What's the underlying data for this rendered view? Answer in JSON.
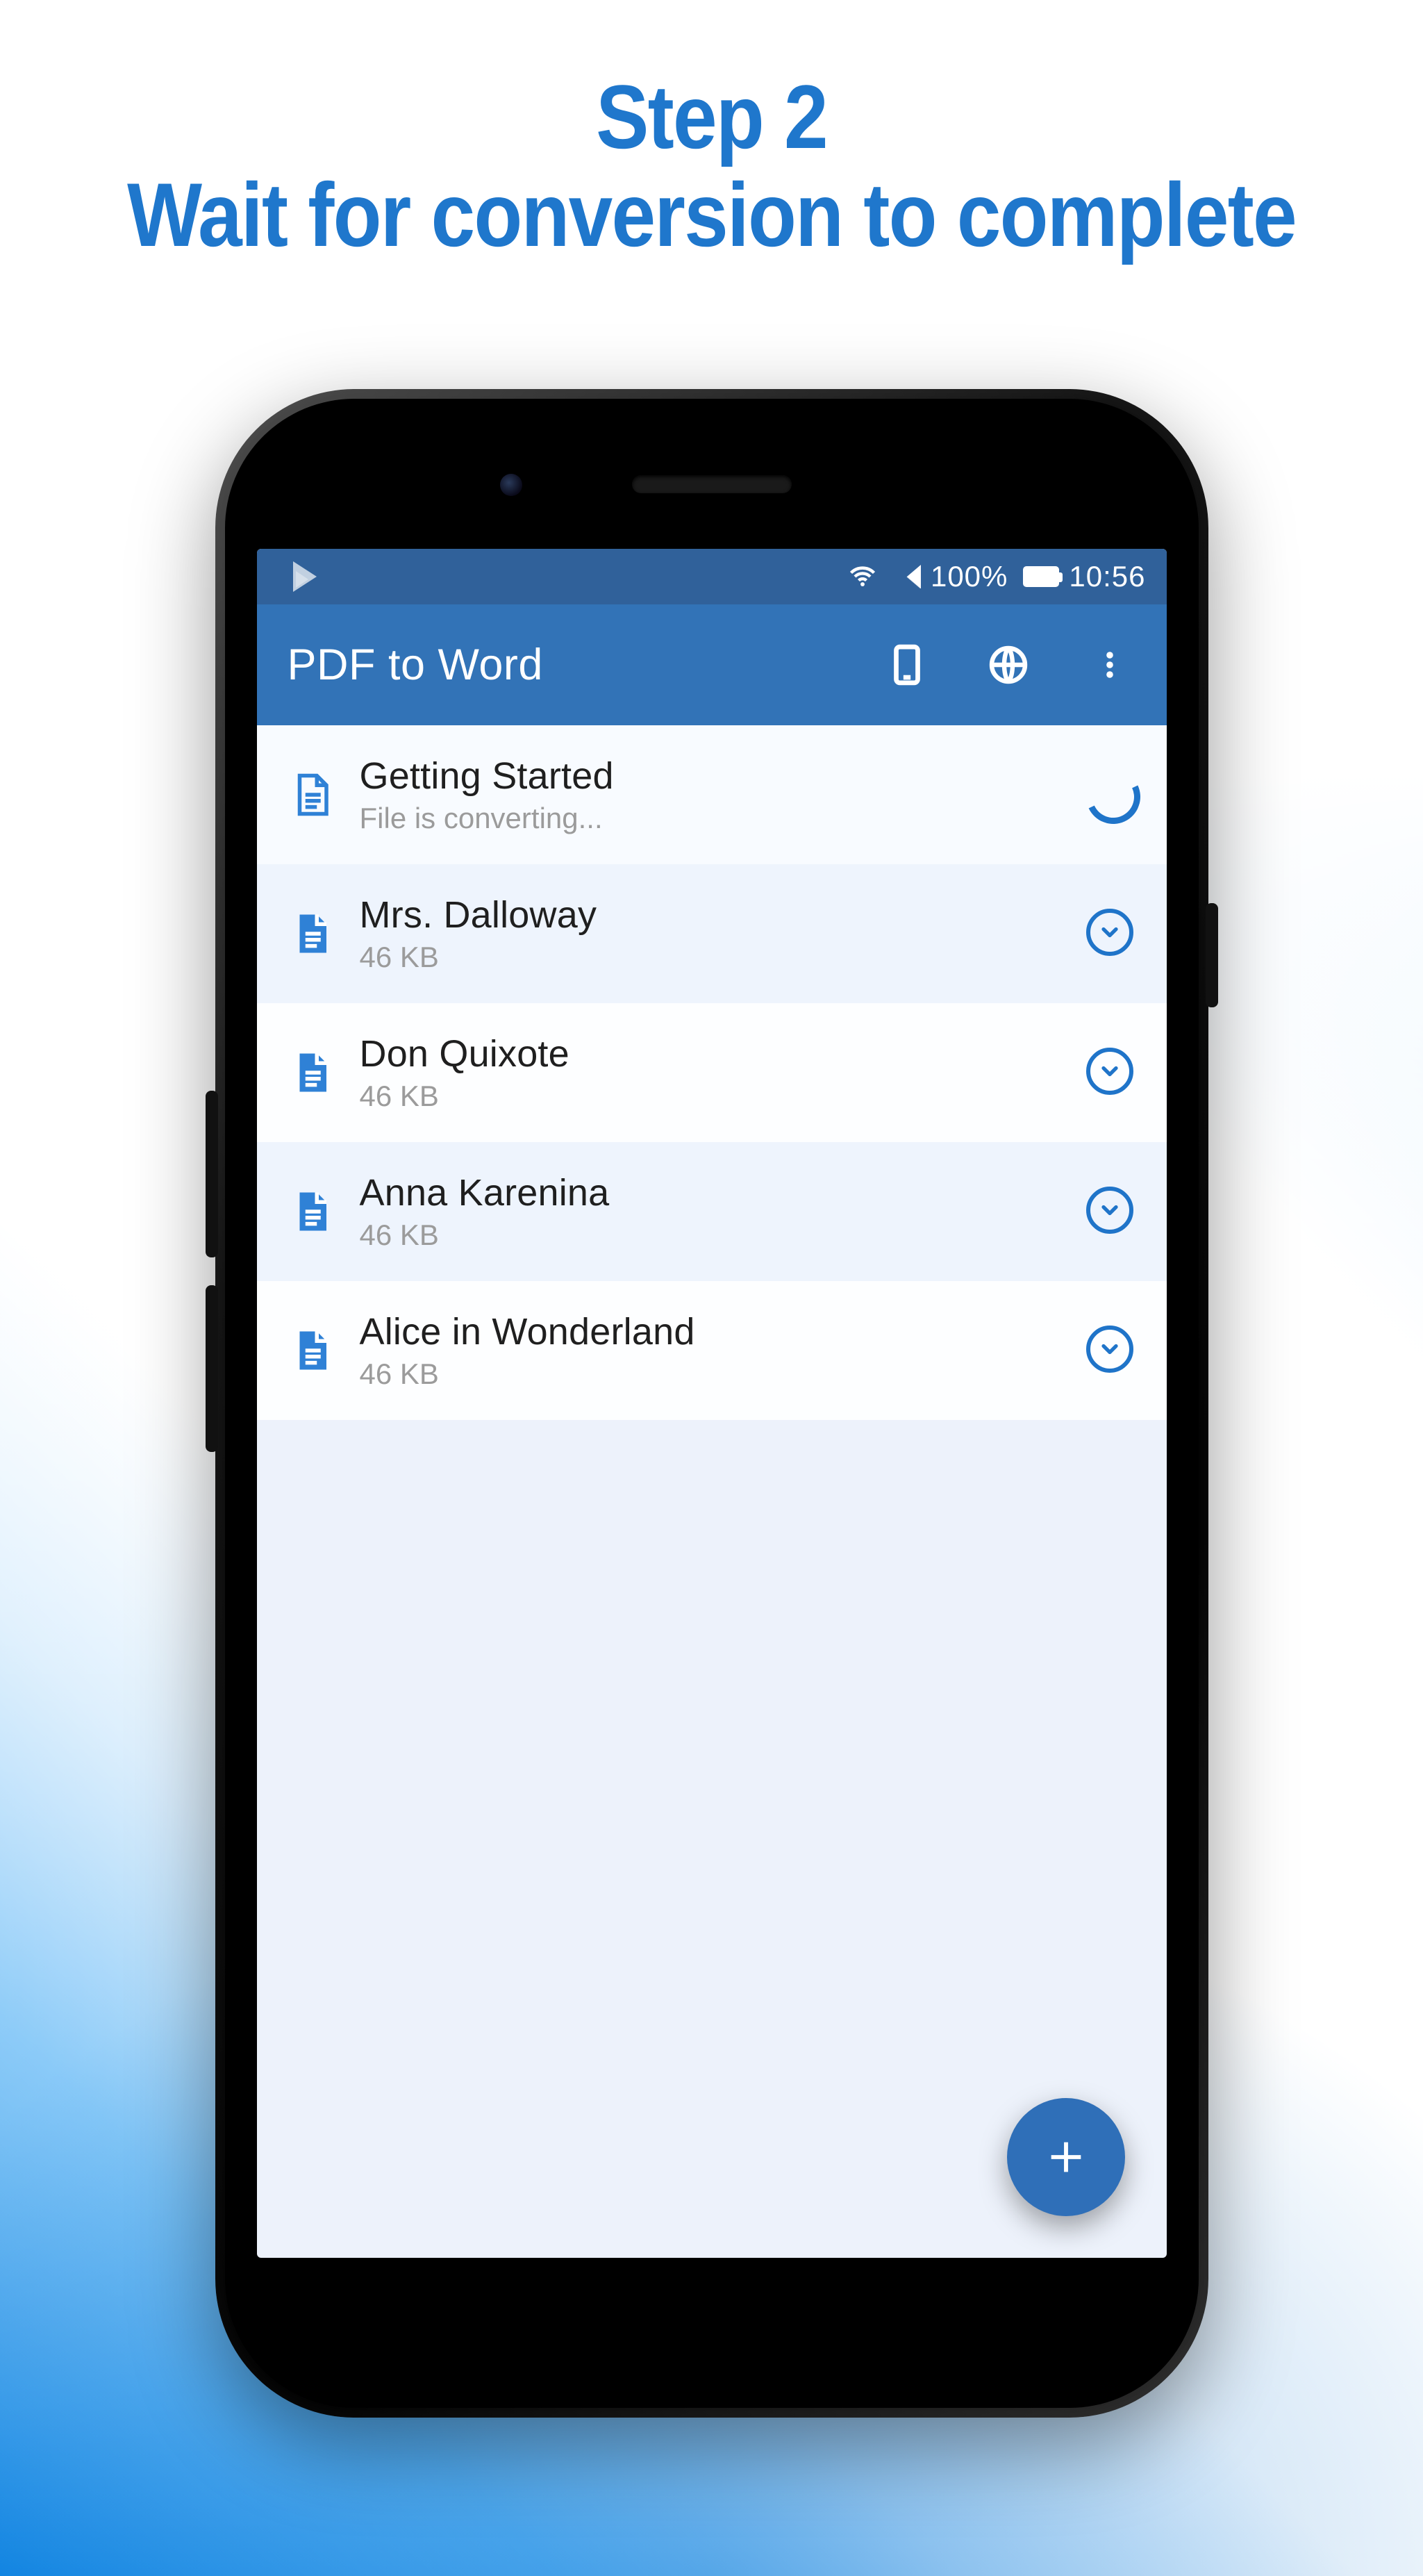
{
  "promo": {
    "line1": "Step 2",
    "line2": "Wait for conversion to complete"
  },
  "statusbar": {
    "battery_pct": "100%",
    "time": "10:56"
  },
  "appbar": {
    "title": "PDF to Word"
  },
  "files": [
    {
      "name": "Getting Started",
      "meta": "File is converting...",
      "state": "converting"
    },
    {
      "name": "Mrs. Dalloway",
      "meta": "46 KB",
      "state": "ready"
    },
    {
      "name": "Don Quixote",
      "meta": "46 KB",
      "state": "ready"
    },
    {
      "name": "Anna Karenina",
      "meta": "46 KB",
      "state": "ready"
    },
    {
      "name": "Alice in Wonderland",
      "meta": "46 KB",
      "state": "ready"
    }
  ]
}
